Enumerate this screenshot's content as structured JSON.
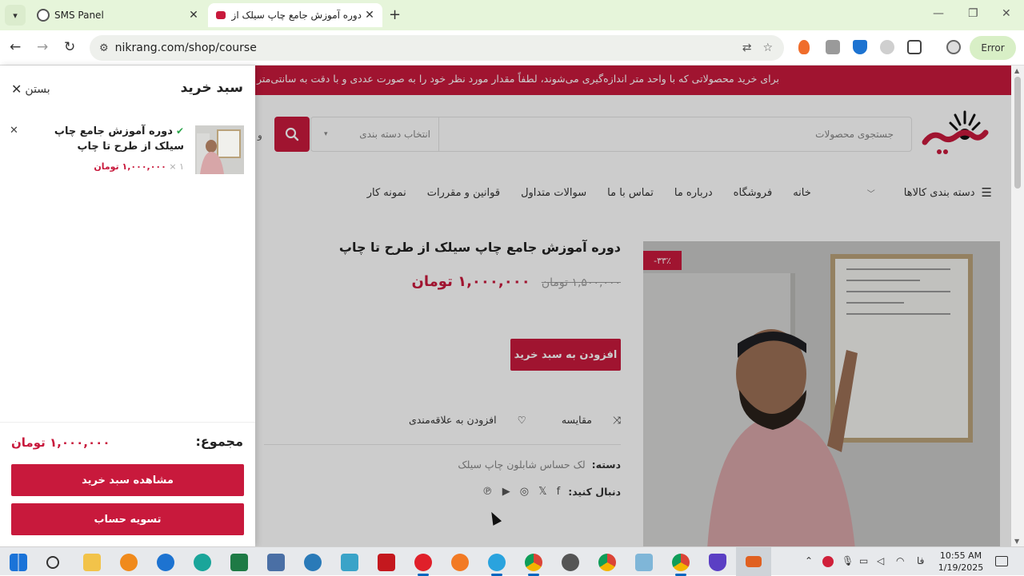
{
  "browser": {
    "tabs": [
      {
        "title": "SMS Panel",
        "active": false
      },
      {
        "title": "دوره آموزش جامع چاپ سیلک از طرح تا چاپ",
        "active": true
      }
    ],
    "url": "nikrang.com/shop/course",
    "profile_button": "Error",
    "icons": [
      "chevron-down-icon",
      "close-icon",
      "plus-icon",
      "minimize-icon",
      "restore-icon",
      "back-icon",
      "forward-icon",
      "reload-icon",
      "tune-icon",
      "translate-icon",
      "star-icon",
      "puzzle-icon"
    ]
  },
  "page": {
    "notice": "برای خرید محصولاتی که با واحد متر اندازه‌گیری می‌شوند، لطفاً مقدار مورد نظر خود را به صورت عددی و با دقت به سانتی‌متر وارد",
    "search": {
      "placeholder": "جستجوی محصولات",
      "category_placeholder": "انتخاب دسته بندی"
    },
    "header_fragment": "و",
    "nav": {
      "categories": "دسته بندی کالاها",
      "links": [
        "خانه",
        "فروشگاه",
        "درباره ما",
        "تماس با ما",
        "سوالات متداول",
        "قوانین و مقررات",
        "نمونه کار"
      ]
    },
    "product": {
      "title": "دوره آموزش جامع چاپ سیلک از طرح تا چاپ",
      "old_price": "۱,۵۰۰,۰۰۰ تومان",
      "new_price": "۱,۰۰۰,۰۰۰ تومان",
      "discount_badge": "-۳۳٪",
      "add_to_cart": "افزودن به سبد خرید",
      "compare": "مقایسه",
      "wishlist": "افزودن به علاقه‌مندی",
      "category_label": "دسته:",
      "category_value": "لک حساس شابلون چاپ سیلک",
      "follow_label": "دنبال کنید:"
    }
  },
  "cart": {
    "title": "سبد خرید",
    "close": "بستن",
    "items": [
      {
        "name": "دوره آموزش جامع چاپ سیلک از طرح تا چاپ",
        "qty": "۱ ×",
        "price": "۱,۰۰۰,۰۰۰ تومان"
      }
    ],
    "total_label": "مجموع:",
    "total_value": "۱,۰۰۰,۰۰۰ تومان",
    "view_cart": "مشاهده سبد خرید",
    "checkout": "تسویه حساب"
  },
  "taskbar": {
    "time": "10:55 AM",
    "date": "1/19/2025",
    "lang": "فا"
  },
  "colors": {
    "brand": "#c8193c",
    "tab_bar": "#e6f5da"
  }
}
